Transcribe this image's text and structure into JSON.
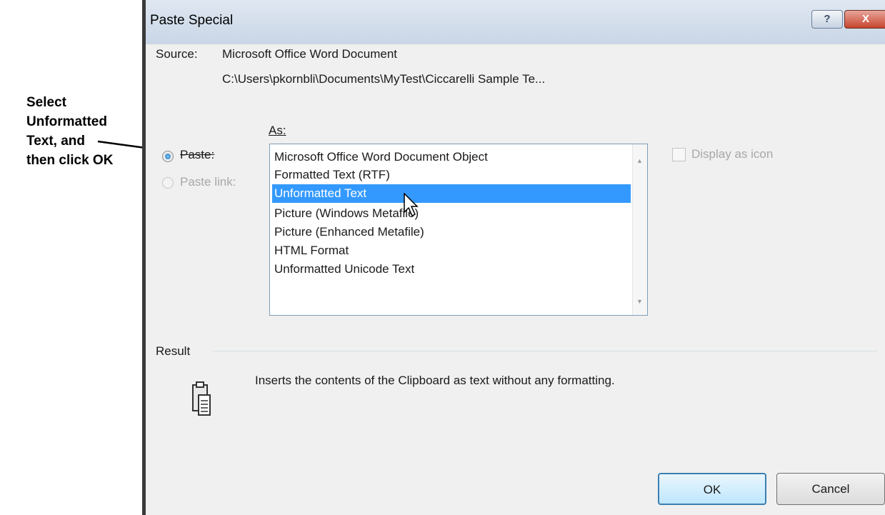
{
  "annotation": {
    "lines": [
      "Select",
      "Unformatted",
      "Text, and",
      "then click OK"
    ]
  },
  "dialog": {
    "title": "Paste Special",
    "help_glyph": "?",
    "close_glyph": "X",
    "source_label": "Source:",
    "source_name": "Microsoft Office Word Document",
    "source_path": "C:\\Users\\pkornbli\\Documents\\MyTest\\Ciccarelli Sample Te...",
    "as_label": "As:",
    "paste_label": "Paste:",
    "paste_link_label": "Paste link:",
    "list_items": [
      "Microsoft Office Word Document Object",
      "Formatted Text (RTF)",
      "Unformatted Text",
      "Picture (Windows Metafile)",
      "Picture (Enhanced Metafile)",
      "HTML Format",
      "Unformatted Unicode Text"
    ],
    "selected_index": 2,
    "display_as_icon_label": "Display as icon",
    "result_label": "Result",
    "result_text": "Inserts the contents of the Clipboard as text without any formatting.",
    "ok_label": "OK",
    "cancel_label": "Cancel"
  },
  "icons": {
    "help": "help-icon",
    "close": "close-icon",
    "clipboard": "clipboard-icon",
    "cursor": "mouse-pointer-icon"
  },
  "colors": {
    "selection": "#3399ff",
    "annotation_text": "#000000"
  }
}
